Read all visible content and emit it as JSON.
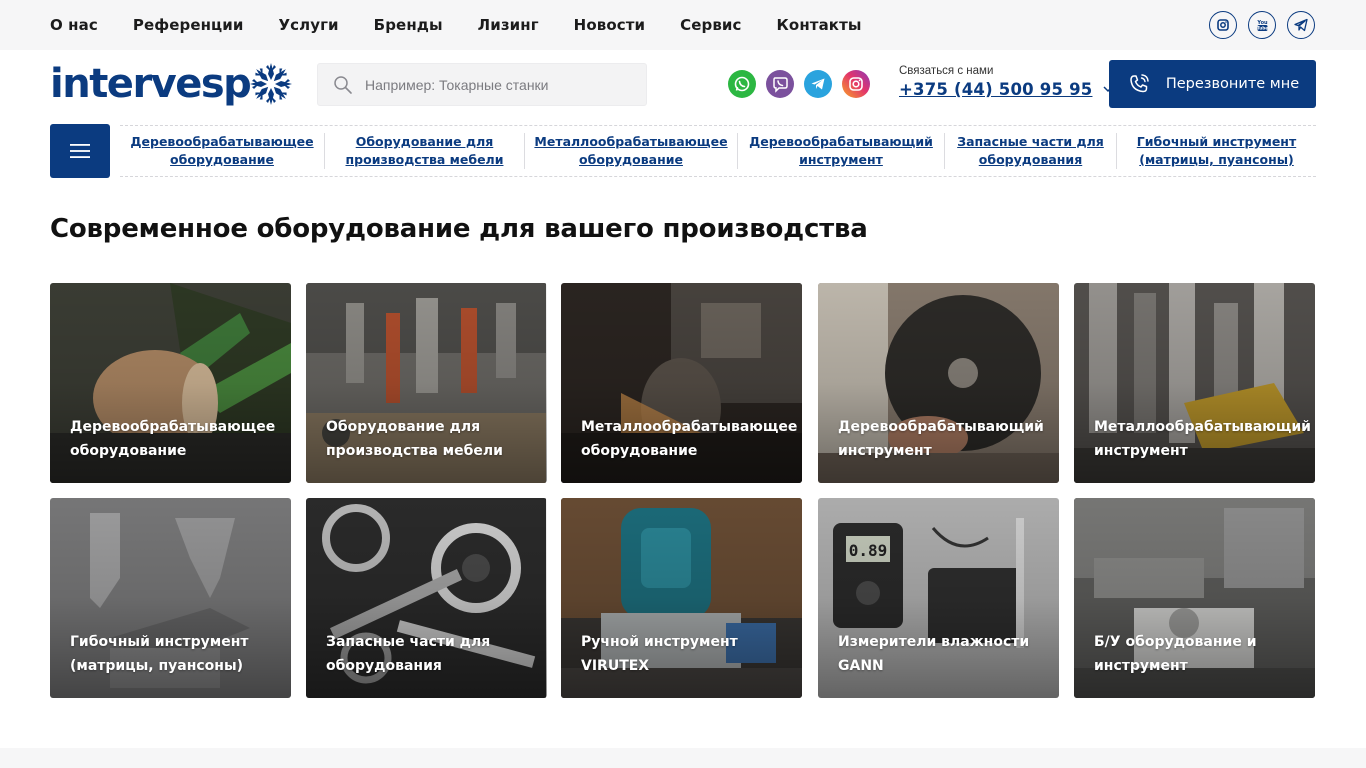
{
  "top_nav": {
    "items": [
      "О нас",
      "Референции",
      "Услуги",
      "Бренды",
      "Лизинг",
      "Новости",
      "Сервис",
      "Контакты"
    ]
  },
  "social": [
    "instagram-icon",
    "youtube-icon",
    "telegram-icon"
  ],
  "logo": {
    "text": "intervesp"
  },
  "search": {
    "placeholder": "Например: Токарные станки"
  },
  "messengers": [
    "whatsapp-icon",
    "viber-icon",
    "telegram-icon",
    "instagram-icon"
  ],
  "contact": {
    "label": "Связаться с нами",
    "phone": "+375 (44) 500 95 95"
  },
  "callback": {
    "label": "Перезвоните мне"
  },
  "category_nav": {
    "items": [
      "Деревообрабатывающее оборудование",
      "Оборудование для производства мебели",
      "Металлообрабатывающее оборудование",
      "Деревообрабатывающий инструмент",
      "Запасные части для оборудования",
      "Гибочный инструмент (матрицы, пуансоны)"
    ]
  },
  "main": {
    "title": "Современное оборудование для вашего производства",
    "cards": [
      {
        "label": "Деревообрабатывающее оборудование",
        "bg": "#4a4a3c"
      },
      {
        "label": "Оборудование для производства мебели",
        "bg": "#5b5a58"
      },
      {
        "label": "Металлообрабатывающее оборудование",
        "bg": "#3f3630"
      },
      {
        "label": "Деревообрабатывающий инструмент",
        "bg": "#6a5e54"
      },
      {
        "label": "Металлообрабатывающий инструмент",
        "bg": "#5d5c5a"
      },
      {
        "label": "Гибочный инструмент (матрицы, пуансоны)",
        "bg": "#7a7a7a"
      },
      {
        "label": "Запасные части для оборудования",
        "bg": "#3e3e3e"
      },
      {
        "label": "Ручной инструмент VIRUTEX",
        "bg": "#4e5050"
      },
      {
        "label": "Измерители влажности GANN",
        "bg": "#8b8b8b"
      },
      {
        "label": "Б/У оборудование и инструмент",
        "bg": "#6d6d6b"
      }
    ]
  },
  "colors": {
    "brand": "#0b3b80",
    "topbar_bg": "#f6f6f7"
  }
}
